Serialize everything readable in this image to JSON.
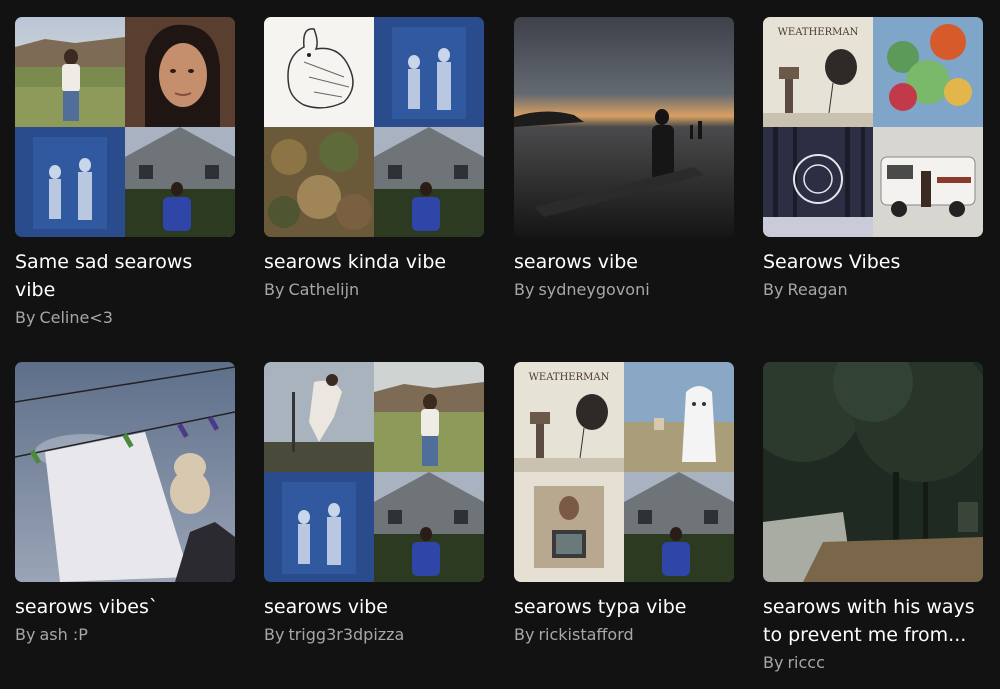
{
  "playlists": [
    {
      "title": "Same sad searows vibe",
      "by_label": "By",
      "author": "Celine<3"
    },
    {
      "title": "searows kinda vibe",
      "by_label": "By",
      "author": "Cathelijn"
    },
    {
      "title": "searows vibe",
      "by_label": "By",
      "author": "sydneygovoni"
    },
    {
      "title": "Searows Vibes",
      "by_label": "By",
      "author": "Reagan"
    },
    {
      "title": "searows vibes`",
      "by_label": "By",
      "author": "ash :P"
    },
    {
      "title": "searows vibe",
      "by_label": "By",
      "author": "trigg3r3dpizza"
    },
    {
      "title": "searows typa vibe",
      "by_label": "By",
      "author": "rickistafford"
    },
    {
      "title": "searows with his ways to prevent me from...",
      "by_label": "By",
      "author": "riccc"
    }
  ],
  "album_art_text": {
    "weatherman": "WEATHERMAN"
  }
}
